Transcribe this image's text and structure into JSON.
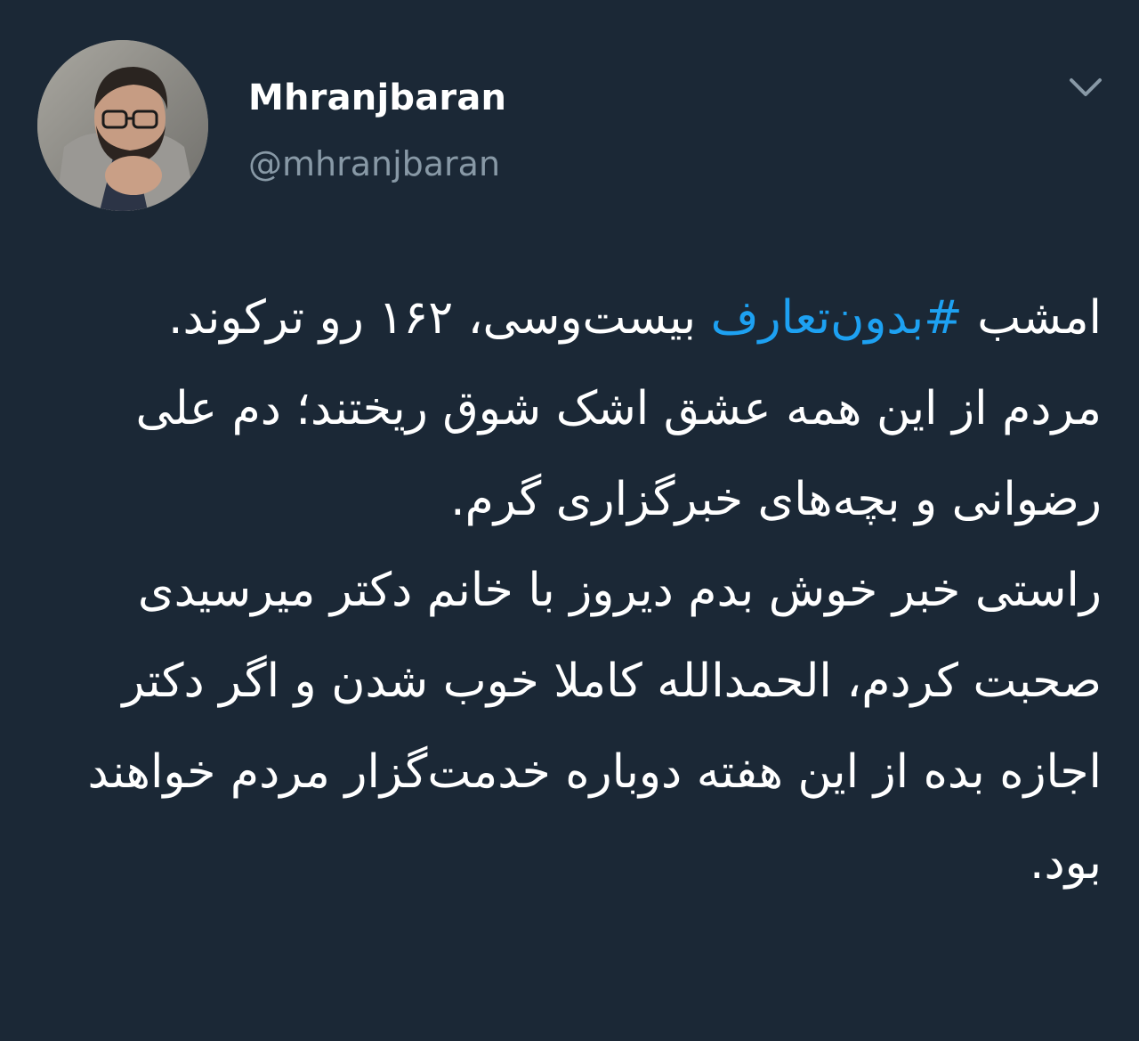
{
  "user": {
    "display_name": "Mhranjbaran",
    "handle": "@mhranjbaran"
  },
  "tweet": {
    "line1_prefix": "امشب ",
    "hashtag": "#بدون‌تعارف",
    "line1_suffix": " بیست‌وسی، ۱۶۲ رو ترکوند.",
    "rest": "مردم از این همه عشق اشک شوق ریختند؛ دم علی رضوانی و بچه‌های خبرگزاری گرم.\nراستی خبر خوش بدم دیروز با خانم دکتر میرسیدی صحبت کردم، الحمدالله کاملا خوب شدن و اگر دکتر اجازه بده از این هفته دوباره خدمت‌گزار مردم خواهند بود."
  },
  "icons": {
    "menu": "chevron-down-icon",
    "avatar": "avatar"
  },
  "colors": {
    "background": "#1b2836",
    "text": "#ffffff",
    "secondary": "#8899a6",
    "link": "#1da1f2"
  }
}
